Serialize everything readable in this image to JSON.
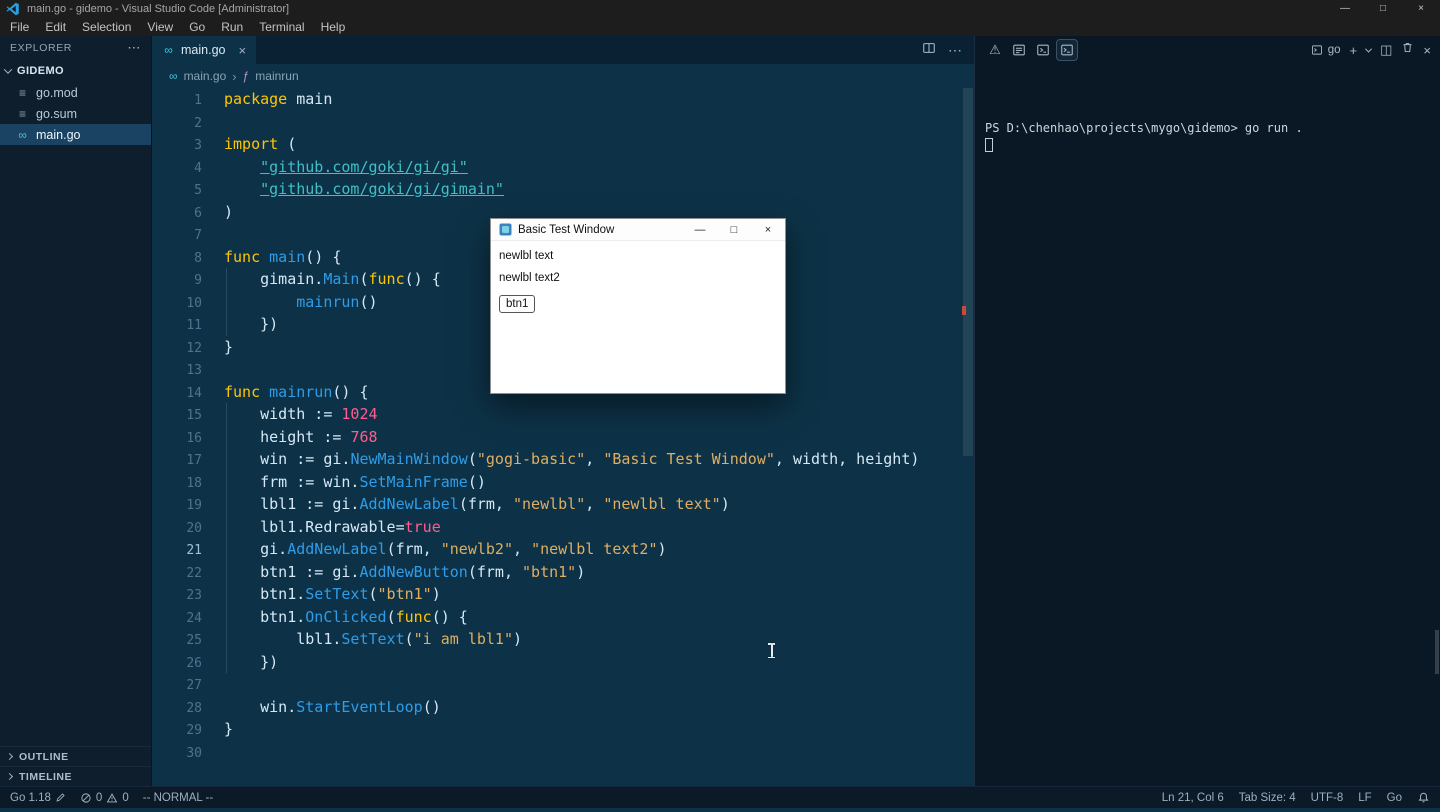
{
  "window": {
    "title": "main.go - gidemo - Visual Studio Code [Administrator]",
    "controls": {
      "minimize": "—",
      "restore": "□",
      "close": "×"
    }
  },
  "menu": {
    "items": [
      "File",
      "Edit",
      "Selection",
      "View",
      "Go",
      "Run",
      "Terminal",
      "Help"
    ]
  },
  "icons": {
    "go_file": "∞",
    "mod_file": "≡",
    "warning": "⚠",
    "more": "⋯",
    "split_sq": "◫",
    "chev": "›",
    "fn_symbol": "ƒ",
    "plus": "+",
    "close": "×"
  },
  "sidebar": {
    "header": "EXPLORER",
    "more_icon": "⋯",
    "project": "GIDEMO",
    "files": [
      {
        "name": "go.mod",
        "icon": "mod"
      },
      {
        "name": "go.sum",
        "icon": "mod"
      },
      {
        "name": "main.go",
        "icon": "go",
        "active": true
      }
    ],
    "sections": [
      "OUTLINE",
      "TIMELINE"
    ]
  },
  "editor": {
    "tab": {
      "label": "main.go",
      "close": "×"
    },
    "breadcrumb": [
      {
        "label": "main.go",
        "icon": "go"
      },
      {
        "label": "mainrun",
        "icon": "fn"
      }
    ],
    "active_line": 21,
    "lines": [
      [
        {
          "t": "package",
          "c": "kw"
        },
        {
          "t": " main",
          "c": "fg"
        }
      ],
      [],
      [
        {
          "t": "import",
          "c": "kw"
        },
        {
          "t": " (",
          "c": "fg"
        }
      ],
      [
        {
          "t": "    ",
          "c": "fg"
        },
        {
          "t": "\"github.com/goki/gi/gi\"",
          "c": "lnk"
        }
      ],
      [
        {
          "t": "    ",
          "c": "fg"
        },
        {
          "t": "\"github.com/goki/gi/gimain\"",
          "c": "lnk"
        }
      ],
      [
        {
          "t": ")",
          "c": "fg"
        }
      ],
      [],
      [
        {
          "t": "func",
          "c": "kw"
        },
        {
          "t": " ",
          "c": "fg"
        },
        {
          "t": "main",
          "c": "fn"
        },
        {
          "t": "() {",
          "c": "fg"
        }
      ],
      [
        {
          "t": "    gimain.",
          "c": "fg"
        },
        {
          "t": "Main",
          "c": "fn"
        },
        {
          "t": "(",
          "c": "fg"
        },
        {
          "t": "func",
          "c": "kw"
        },
        {
          "t": "() {",
          "c": "fg"
        }
      ],
      [
        {
          "t": "        ",
          "c": "fg"
        },
        {
          "t": "mainrun",
          "c": "fn"
        },
        {
          "t": "()",
          "c": "fg"
        }
      ],
      [
        {
          "t": "    })",
          "c": "fg"
        }
      ],
      [
        {
          "t": "}",
          "c": "fg"
        }
      ],
      [],
      [
        {
          "t": "func",
          "c": "kw"
        },
        {
          "t": " ",
          "c": "fg"
        },
        {
          "t": "mainrun",
          "c": "fn"
        },
        {
          "t": "() {",
          "c": "fg"
        }
      ],
      [
        {
          "t": "    width := ",
          "c": "fg"
        },
        {
          "t": "1024",
          "c": "num"
        }
      ],
      [
        {
          "t": "    height := ",
          "c": "fg"
        },
        {
          "t": "768",
          "c": "num"
        }
      ],
      [
        {
          "t": "    win := gi.",
          "c": "fg"
        },
        {
          "t": "NewMainWindow",
          "c": "fn"
        },
        {
          "t": "(",
          "c": "fg"
        },
        {
          "t": "\"gogi-basic\"",
          "c": "str"
        },
        {
          "t": ", ",
          "c": "fg"
        },
        {
          "t": "\"Basic Test Window\"",
          "c": "str"
        },
        {
          "t": ", width, height)",
          "c": "fg"
        }
      ],
      [
        {
          "t": "    frm := win.",
          "c": "fg"
        },
        {
          "t": "SetMainFrame",
          "c": "fn"
        },
        {
          "t": "()",
          "c": "fg"
        }
      ],
      [
        {
          "t": "    lbl1 := gi.",
          "c": "fg"
        },
        {
          "t": "AddNewLabel",
          "c": "fn"
        },
        {
          "t": "(frm, ",
          "c": "fg"
        },
        {
          "t": "\"newlbl\"",
          "c": "str"
        },
        {
          "t": ", ",
          "c": "fg"
        },
        {
          "t": "\"newlbl text\"",
          "c": "str"
        },
        {
          "t": ")",
          "c": "fg"
        }
      ],
      [
        {
          "t": "    lbl1.Redrawable=",
          "c": "fg"
        },
        {
          "t": "true",
          "c": "num"
        }
      ],
      [
        {
          "t": "    gi.",
          "c": "fg"
        },
        {
          "t": "AddNewLabel",
          "c": "fn"
        },
        {
          "t": "(frm, ",
          "c": "fg"
        },
        {
          "t": "\"newlb2\"",
          "c": "str"
        },
        {
          "t": ", ",
          "c": "fg"
        },
        {
          "t": "\"newlbl text2\"",
          "c": "str"
        },
        {
          "t": ")",
          "c": "fg"
        }
      ],
      [
        {
          "t": "    btn1 := gi.",
          "c": "fg"
        },
        {
          "t": "AddNewButton",
          "c": "fn"
        },
        {
          "t": "(frm, ",
          "c": "fg"
        },
        {
          "t": "\"btn1\"",
          "c": "str"
        },
        {
          "t": ")",
          "c": "fg"
        }
      ],
      [
        {
          "t": "    btn1.",
          "c": "fg"
        },
        {
          "t": "SetText",
          "c": "fn"
        },
        {
          "t": "(",
          "c": "fg"
        },
        {
          "t": "\"btn1\"",
          "c": "str"
        },
        {
          "t": ")",
          "c": "fg"
        }
      ],
      [
        {
          "t": "    btn1.",
          "c": "fg"
        },
        {
          "t": "OnClicked",
          "c": "fn"
        },
        {
          "t": "(",
          "c": "fg"
        },
        {
          "t": "func",
          "c": "kw"
        },
        {
          "t": "() {",
          "c": "fg"
        }
      ],
      [
        {
          "t": "        lbl1.",
          "c": "fg"
        },
        {
          "t": "SetText",
          "c": "fn"
        },
        {
          "t": "(",
          "c": "fg"
        },
        {
          "t": "\"i am lbl1\"",
          "c": "str"
        },
        {
          "t": ")",
          "c": "fg"
        }
      ],
      [
        {
          "t": "    })",
          "c": "fg"
        }
      ],
      [],
      [
        {
          "t": "    win.",
          "c": "fg"
        },
        {
          "t": "StartEventLoop",
          "c": "fn"
        },
        {
          "t": "()",
          "c": "fg"
        }
      ],
      [
        {
          "t": "}",
          "c": "fg"
        }
      ],
      []
    ]
  },
  "app_window": {
    "title": "Basic Test Window",
    "labels": [
      "newlbl text",
      "newlbl text2"
    ],
    "button": "btn1",
    "controls": {
      "minimize": "—",
      "maximize": "□",
      "close": "×"
    }
  },
  "panel": {
    "profile": "go",
    "terminal": {
      "prompt": "PS D:\\chenhao\\projects\\mygo\\gidemo>",
      "command": "go run ."
    }
  },
  "status_bar": {
    "go_version": "Go 1.18",
    "errors": "0",
    "warnings": "0",
    "mode": "-- NORMAL --",
    "line_col": "Ln 21, Col 6",
    "tab_size": "Tab Size: 4",
    "encoding": "UTF-8",
    "eol": "LF",
    "language": "Go"
  },
  "colors": {
    "editor_bg": "#0d3247",
    "keyword": "#ffc600",
    "function": "#2e9ce8",
    "string": "#dfae62",
    "import_link": "#41bfc6",
    "number": "#ff5d8f",
    "file_icon_cyan": "#3ec6d8",
    "selection_bg": "#1a4263"
  }
}
